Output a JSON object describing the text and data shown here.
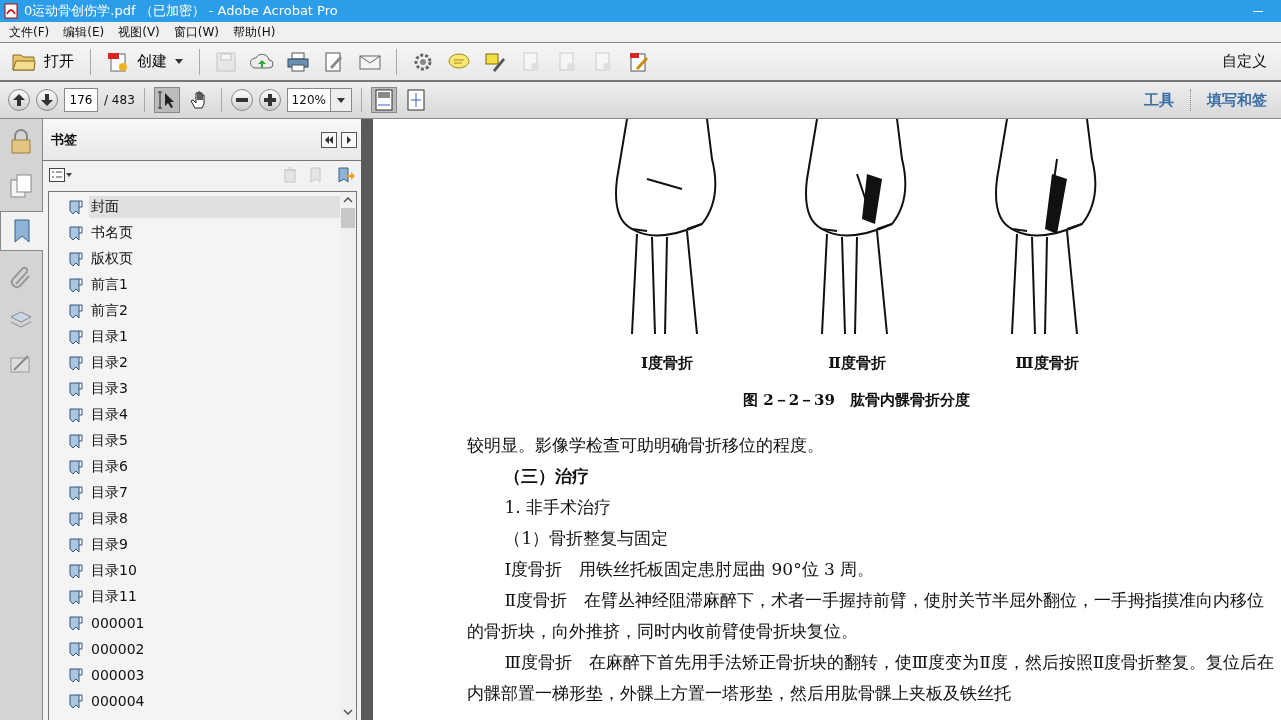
{
  "window": {
    "title": "0运动骨创伤学.pdf （已加密） - Adobe Acrobat Pro"
  },
  "menu": [
    "文件(F)",
    "编辑(E)",
    "视图(V)",
    "窗口(W)",
    "帮助(H)"
  ],
  "toolbar": {
    "open": "打开",
    "create": "创建",
    "customize": "自定义",
    "tools": [
      {
        "kind": "save",
        "disabled": true
      },
      {
        "kind": "upload",
        "disabled": false
      },
      {
        "kind": "print",
        "disabled": false
      },
      {
        "kind": "edit",
        "disabled": false
      },
      {
        "kind": "mail",
        "disabled": false
      },
      {
        "kind": "gear",
        "disabled": false
      },
      {
        "kind": "comment",
        "disabled": false
      },
      {
        "kind": "highlight",
        "disabled": false
      },
      {
        "kind": "doc",
        "disabled": true
      },
      {
        "kind": "doc",
        "disabled": true
      },
      {
        "kind": "doc",
        "disabled": true
      },
      {
        "kind": "sign",
        "disabled": false
      }
    ]
  },
  "navigation": {
    "page": "176",
    "page_total": "/ 483",
    "zoom": "120%",
    "links": [
      "工具",
      "填写和签"
    ]
  },
  "side_tabs": [
    {
      "kind": "lock",
      "selected": false
    },
    {
      "kind": "pages",
      "selected": false
    },
    {
      "kind": "bookmark",
      "selected": true
    },
    {
      "kind": "clip",
      "selected": false
    },
    {
      "kind": "layers",
      "selected": false
    },
    {
      "kind": "sign",
      "selected": false
    }
  ],
  "bookmarks_panel": {
    "title": "书签",
    "items": [
      {
        "label": "封面",
        "selected": true
      },
      {
        "label": "书名页",
        "selected": false
      },
      {
        "label": "版权页",
        "selected": false
      },
      {
        "label": "前言1",
        "selected": false
      },
      {
        "label": "前言2",
        "selected": false
      },
      {
        "label": "目录1",
        "selected": false
      },
      {
        "label": "目录2",
        "selected": false
      },
      {
        "label": "目录3",
        "selected": false
      },
      {
        "label": "目录4",
        "selected": false
      },
      {
        "label": "目录5",
        "selected": false
      },
      {
        "label": "目录6",
        "selected": false
      },
      {
        "label": "目录7",
        "selected": false
      },
      {
        "label": "目录8",
        "selected": false
      },
      {
        "label": "目录9",
        "selected": false
      },
      {
        "label": "目录10",
        "selected": false
      },
      {
        "label": "目录11",
        "selected": false
      },
      {
        "label": "000001",
        "selected": false
      },
      {
        "label": "000002",
        "selected": false
      },
      {
        "label": "000003",
        "selected": false
      },
      {
        "label": "000004",
        "selected": false
      }
    ]
  },
  "document": {
    "figure_labels": [
      "Ⅰ度骨折",
      "Ⅱ度骨折",
      "Ⅲ度骨折"
    ],
    "figure_caption": "图 2－2－39　肱骨内髁骨折分度",
    "paragraphs": [
      {
        "kind": "continued",
        "text": "较明显。影像学检查可助明确骨折移位的程度。"
      },
      {
        "kind": "heading",
        "text": "（三）治疗"
      },
      {
        "kind": "subheading",
        "text": "1. 非手术治疗"
      },
      {
        "kind": "body",
        "text": "（1）骨折整复与固定"
      },
      {
        "kind": "body",
        "text": "Ⅰ度骨折　用铁丝托板固定患肘屈曲 90°位 3 周。"
      },
      {
        "kind": "body",
        "text": "Ⅱ度骨折　在臂丛神经阻滞麻醉下，术者一手握持前臂，使肘关节半屈外翻位，一手拇指摸准向内移位的骨折块，向外推挤，同时内收前臂使骨折块复位。"
      },
      {
        "kind": "body",
        "text": "Ⅲ度骨折　在麻醉下首先用手法矫正骨折块的翻转，使Ⅲ度变为Ⅱ度，然后按照Ⅱ度骨折整复。复位后在内髁部置一梯形垫，外髁上方置一塔形垫，然后用肱骨髁上夹板及铁丝托"
      }
    ]
  }
}
